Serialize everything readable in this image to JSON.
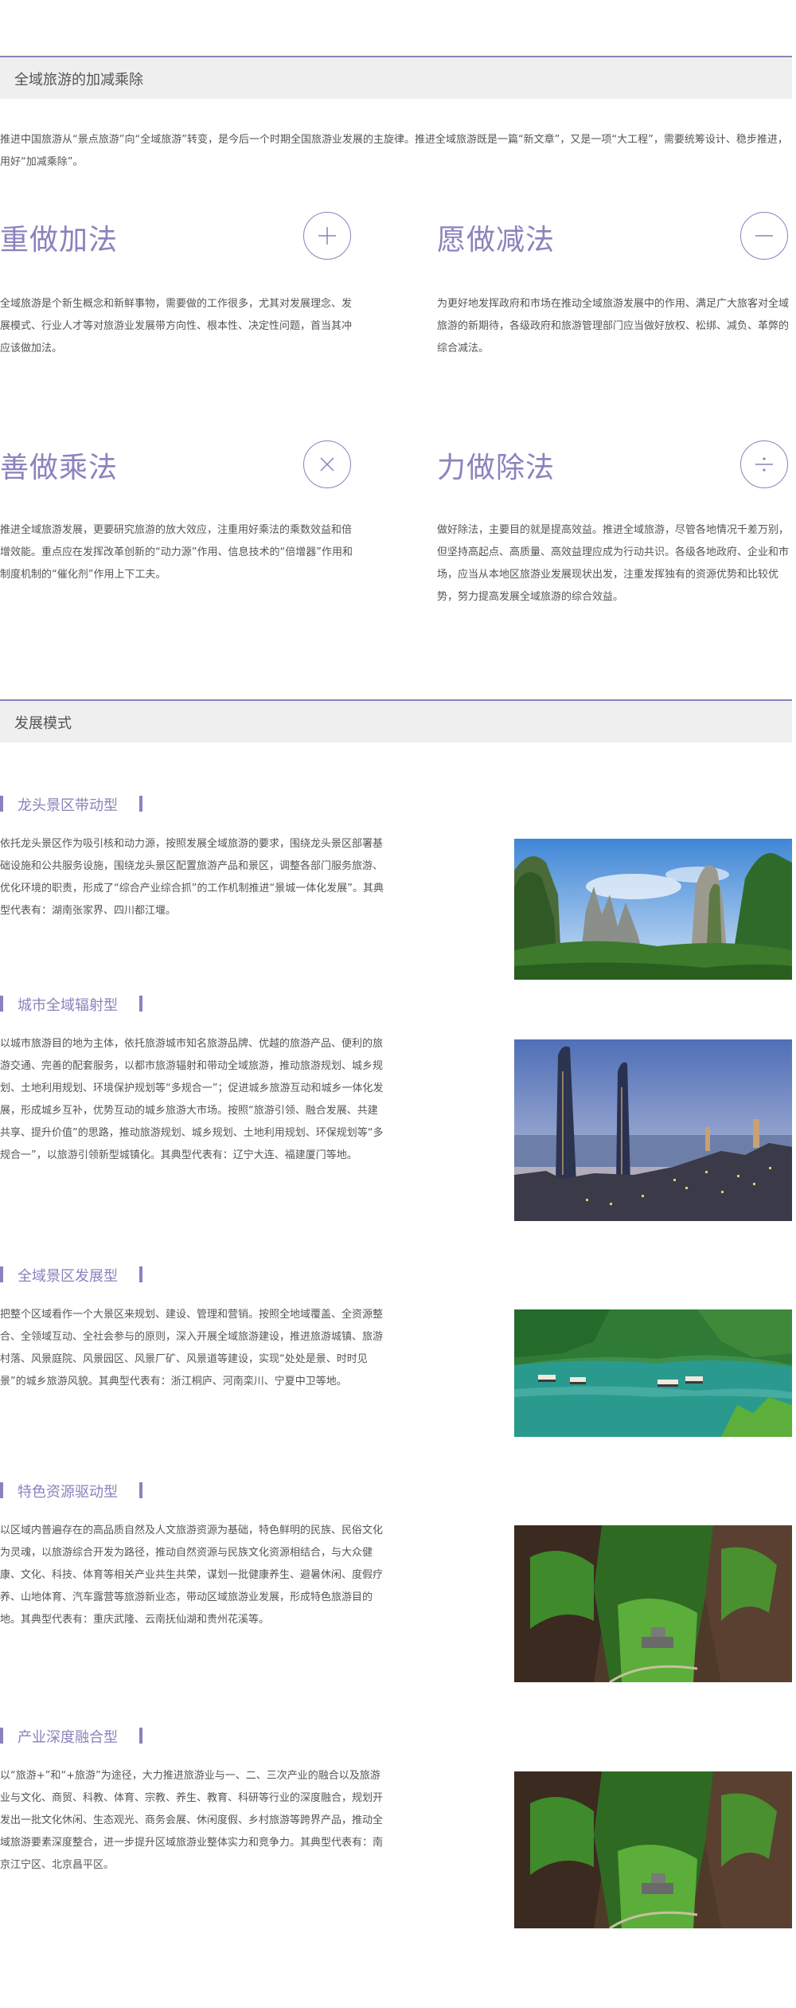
{
  "section1": {
    "title": "全域旅游的加减乘除",
    "intro": "推进中国旅游从“景点旅游”向“全域旅游”转变，是今后一个时期全国旅游业发展的主旋律。推进全域旅游既是一篇“新文章”，又是一项“大工程”，需要统筹设计、稳步推进，用好“加减乘除”。"
  },
  "operations": [
    {
      "title": "重做加法",
      "icon": "plus-icon",
      "text": "全域旅游是个新生概念和新鲜事物，需要做的工作很多，尤其对发展理念、发展模式、行业人才等对旅游业发展带方向性、根本性、决定性问题，首当其冲应该做加法。"
    },
    {
      "title": "愿做减法",
      "icon": "minus-icon",
      "text": "为更好地发挥政府和市场在推动全域旅游发展中的作用、满足广大旅客对全域旅游的新期待，各级政府和旅游管理部门应当做好放权、松绑、减负、革弊的综合减法。"
    },
    {
      "title": "善做乘法",
      "icon": "multiply-icon",
      "text": "推进全域旅游发展，更要研究旅游的放大效应，注重用好乘法的乘数效益和倍增效能。重点应在发挥改革创新的“动力源”作用、信息技术的“倍增器”作用和制度机制的“催化剂”作用上下工夫。"
    },
    {
      "title": "力做除法",
      "icon": "divide-icon",
      "text": "做好除法，主要目的就是提高效益。推进全域旅游，尽管各地情况千差万别，但坚持高起点、高质量、高效益理应成为行动共识。各级各地政府、企业和市场，应当从本地区旅游业发展现状出发，注重发挥独有的资源优势和比较优势，努力提高发展全域旅游的综合效益。"
    }
  ],
  "section2": {
    "title": "发展模式"
  },
  "modes": [
    {
      "title": "龙头景区带动型",
      "image": "karst-mountains-photo",
      "text": "依托龙头景区作为吸引核和动力源，按照发展全域旅游的要求，围绕龙头景区部署基础设施和公共服务设施，围绕龙头景区配置旅游产品和景区，调整各部门服务旅游、优化环境的职责，形成了“综合产业综合抓”的工作机制推进“景城一体化发展”。其典型代表有：湖南张家界、四川都江堰。"
    },
    {
      "title": "城市全域辐射型",
      "image": "city-skyline-photo",
      "text": "以城市旅游目的地为主体，依托旅游城市知名旅游品牌、优越的旅游产品、便利的旅游交通、完善的配套服务，以都市旅游辐射和带动全域旅游，推动旅游规划、城乡规划、土地利用规划、环境保护规划等“多规合一”；促进城乡旅游互动和城乡一体化发展，形成城乡互补，优势互动的城乡旅游大市场。按照“旅游引领、融合发展、共建共享、提升价值”的思路，推动旅游规划、城乡规划、土地利用规划、环保规划等“多规合一”，以旅游引领新型城镇化。其典型代表有：辽宁大连、福建厦门等地。"
    },
    {
      "title": "全域景区发展型",
      "image": "river-boats-photo",
      "text": "把整个区域看作一个大景区来规划、建设、管理和营销。按照全地域覆盖、全资源整合、全领域互动、全社会参与的原则，深入开展全域旅游建设，推进旅游城镇、旅游村落、风景庭院、风景园区、风景厂矿、风景道等建设，实现“处处是景、时时见景”的城乡旅游风貌。其典型代表有：浙江桐庐、河南栾川、宁夏中卫等地。"
    },
    {
      "title": "特色资源驱动型",
      "image": "canyon-village-photo",
      "text": "以区域内普遍存在的高品质自然及人文旅游资源为基础，特色鲜明的民族、民俗文化为灵魂，以旅游综合开发为路径，推动自然资源与民族文化资源相结合，与大众健康、文化、科技、体育等相关产业共生共荣，谋划一批健康养生、避暑休闲、度假疗养、山地体育、汽车露营等旅游新业态，带动区域旅游业发展，形成特色旅游目的地。其典型代表有：重庆武隆、云南抚仙湖和贵州花溪等。"
    },
    {
      "title": "产业深度融合型",
      "image": "canyon-village-photo",
      "text": "以“旅游+”和“+旅游”为途径，大力推进旅游业与一、二、三次产业的融合以及旅游业与文化、商贸、科教、体育、宗教、养生、教育、科研等行业的深度融合，规划开发出一批文化休闲、生态观光、商务会展、休闲度假、乡村旅游等跨界产品，推动全域旅游要素深度整合，进一步提升区域旅游业整体实力和竞争力。其典型代表有：南京江宁区、北京昌平区。"
    }
  ]
}
